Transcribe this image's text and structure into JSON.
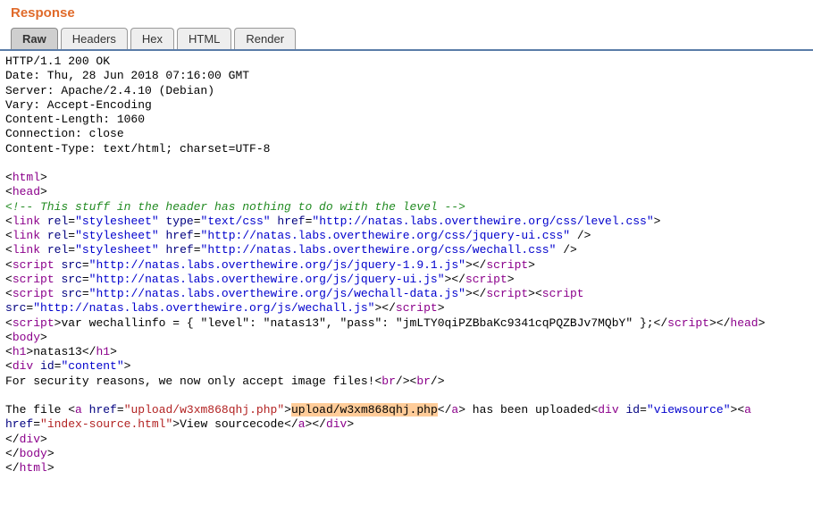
{
  "header": {
    "title": "Response"
  },
  "tabs": [
    {
      "label": "Raw",
      "active": true
    },
    {
      "label": "Headers",
      "active": false
    },
    {
      "label": "Hex",
      "active": false
    },
    {
      "label": "HTML",
      "active": false
    },
    {
      "label": "Render",
      "active": false
    }
  ],
  "http_headers": {
    "status": "HTTP/1.1 200 OK",
    "date": "Date: Thu, 28 Jun 2018 07:16:00 GMT",
    "server": "Server: Apache/2.4.10 (Debian)",
    "vary": "Vary: Accept-Encoding",
    "content_length": "Content-Length: 1060",
    "connection": "Connection: close",
    "content_type": "Content-Type: text/html; charset=UTF-8"
  },
  "body": {
    "tag_open_lt": "<",
    "tag_close_lt": "</",
    "tag_gt": ">",
    "tag_selfclose": "/>",
    "html": "html",
    "head": "head",
    "body_tag": "body",
    "h1": "h1",
    "div": "div",
    "br": "br",
    "a": "a",
    "link": "link",
    "script": "script",
    "comment": "<!-- This stuff in the header has nothing to do with the level -->",
    "rel": "rel",
    "stylesheet": "\"stylesheet\"",
    "type": "type",
    "textcss": "\"text/css\"",
    "href": "href",
    "id": "id",
    "src": "src",
    "eq": "=",
    "sp": " ",
    "css_level": "\"http://natas.labs.overthewire.org/css/level.css\"",
    "css_jqueryui": "\"http://natas.labs.overthewire.org/css/jquery-ui.css\"",
    "css_wechall": "\"http://natas.labs.overthewire.org/css/wechall.css\"",
    "js_jquery": "\"http://natas.labs.overthewire.org/js/jquery-1.9.1.js\"",
    "js_jqueryui": "\"http://natas.labs.overthewire.org/js/jquery-ui.js\"",
    "js_wechalldata": "\"http://natas.labs.overthewire.org/js/wechall-data.js\"",
    "js_wechall": "\"http://natas.labs.overthewire.org/js/wechall.js\"",
    "wechallinfo": "var wechallinfo = { \"level\": \"natas13\", \"pass\": \"jmLTY0qiPZBbaKc9341cqPQZBJv7MQbY\" };",
    "h1_text": "natas13",
    "content_id": "\"content\"",
    "sec_text": "For security reasons, we now only accept image files!",
    "thefile_pre": "The file ",
    "upload_href": "\"upload/w3xm868qhj.php\"",
    "upload_text": "upload/w3xm868qhj.php",
    "uploaded_post": " has been uploaded",
    "viewsource_id": "\"viewsource\"",
    "indexsource_href": "\"index-source.html\"",
    "view_source_text": "View sourcecode"
  }
}
